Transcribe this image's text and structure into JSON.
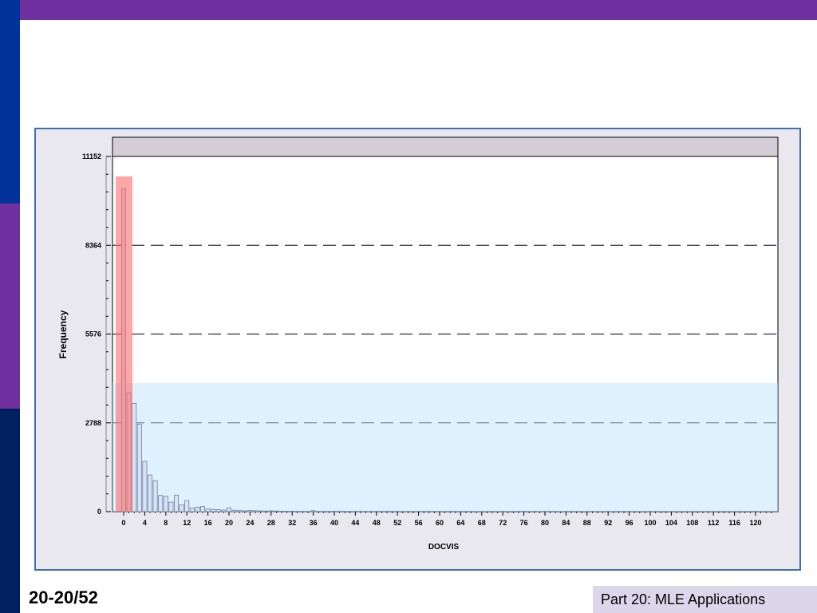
{
  "slide": {
    "number_label": "20-20/52",
    "footer": "Part 20: MLE Applications"
  },
  "colors": {
    "top_bar": "#7030a0",
    "strip": [
      "#003399",
      "#7030a0",
      "#002060"
    ],
    "bar_fill": "#d8e4f5",
    "bar_stroke": "#6d7f9e",
    "highlight_red": "#ff6b6b",
    "highlight_blue": "#bfe3fb"
  },
  "chart_data": {
    "type": "bar",
    "xlabel": "DOCVIS",
    "ylabel": "Frequency",
    "ylim": [
      0,
      11152
    ],
    "yticks": [
      0,
      2788,
      5576,
      8364,
      11152
    ],
    "xticks": [
      0,
      4,
      8,
      12,
      16,
      20,
      24,
      28,
      32,
      36,
      40,
      44,
      48,
      52,
      56,
      60,
      64,
      68,
      72,
      76,
      80,
      84,
      88,
      92,
      96,
      100,
      104,
      108,
      112,
      116,
      120
    ],
    "grid": "dashed horizontal at y ticks",
    "x": [
      0,
      1,
      2,
      3,
      4,
      5,
      6,
      7,
      8,
      9,
      10,
      11,
      12,
      13,
      14,
      15,
      16,
      17,
      18,
      19,
      20,
      21,
      22,
      23,
      24,
      25,
      26,
      27,
      28,
      29,
      30,
      31,
      32,
      33,
      34,
      35,
      36,
      37,
      38,
      39,
      40,
      41,
      42,
      43,
      44,
      45,
      46,
      47,
      48,
      49,
      50,
      51,
      52,
      54,
      56,
      57,
      58,
      59,
      60,
      62,
      63,
      64,
      65,
      66,
      70,
      72,
      75,
      76,
      78,
      80,
      81,
      82,
      84,
      85,
      89,
      92,
      94,
      95,
      96,
      100,
      120
    ],
    "values": [
      10150,
      3730,
      3400,
      2750,
      1580,
      1150,
      970,
      510,
      480,
      300,
      520,
      210,
      350,
      110,
      140,
      160,
      85,
      70,
      60,
      50,
      120,
      45,
      35,
      25,
      40,
      30,
      25,
      20,
      25,
      20,
      15,
      15,
      15,
      10,
      10,
      8,
      30,
      8,
      8,
      8,
      12,
      8,
      8,
      8,
      8,
      8,
      8,
      8,
      8,
      8,
      8,
      8,
      8,
      8,
      8,
      8,
      8,
      8,
      8,
      8,
      8,
      8,
      8,
      8,
      8,
      8,
      8,
      8,
      8,
      8,
      8,
      8,
      8,
      8,
      8,
      8,
      8,
      8,
      8,
      8,
      8
    ]
  }
}
